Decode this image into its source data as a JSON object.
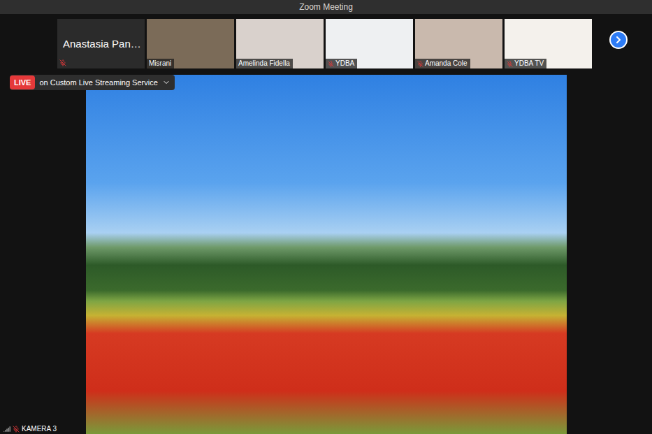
{
  "window": {
    "title": "Zoom Meeting"
  },
  "participants": [
    {
      "name": "Anastasia Pan…",
      "kind": "name",
      "muted": true
    },
    {
      "name": "Misrani",
      "kind": "video",
      "muted": false
    },
    {
      "name": "Amelinda Fidella",
      "kind": "video",
      "muted": false
    },
    {
      "name": "YDBA",
      "kind": "video",
      "muted": true
    },
    {
      "name": "Amanda Cole",
      "kind": "video",
      "muted": true
    },
    {
      "name": "YDBA TV",
      "kind": "video",
      "muted": true
    }
  ],
  "live": {
    "badge": "LIVE",
    "service": "on Custom Live Streaming Service"
  },
  "main_video": {
    "label": "KAMERA 3",
    "muted": true
  }
}
